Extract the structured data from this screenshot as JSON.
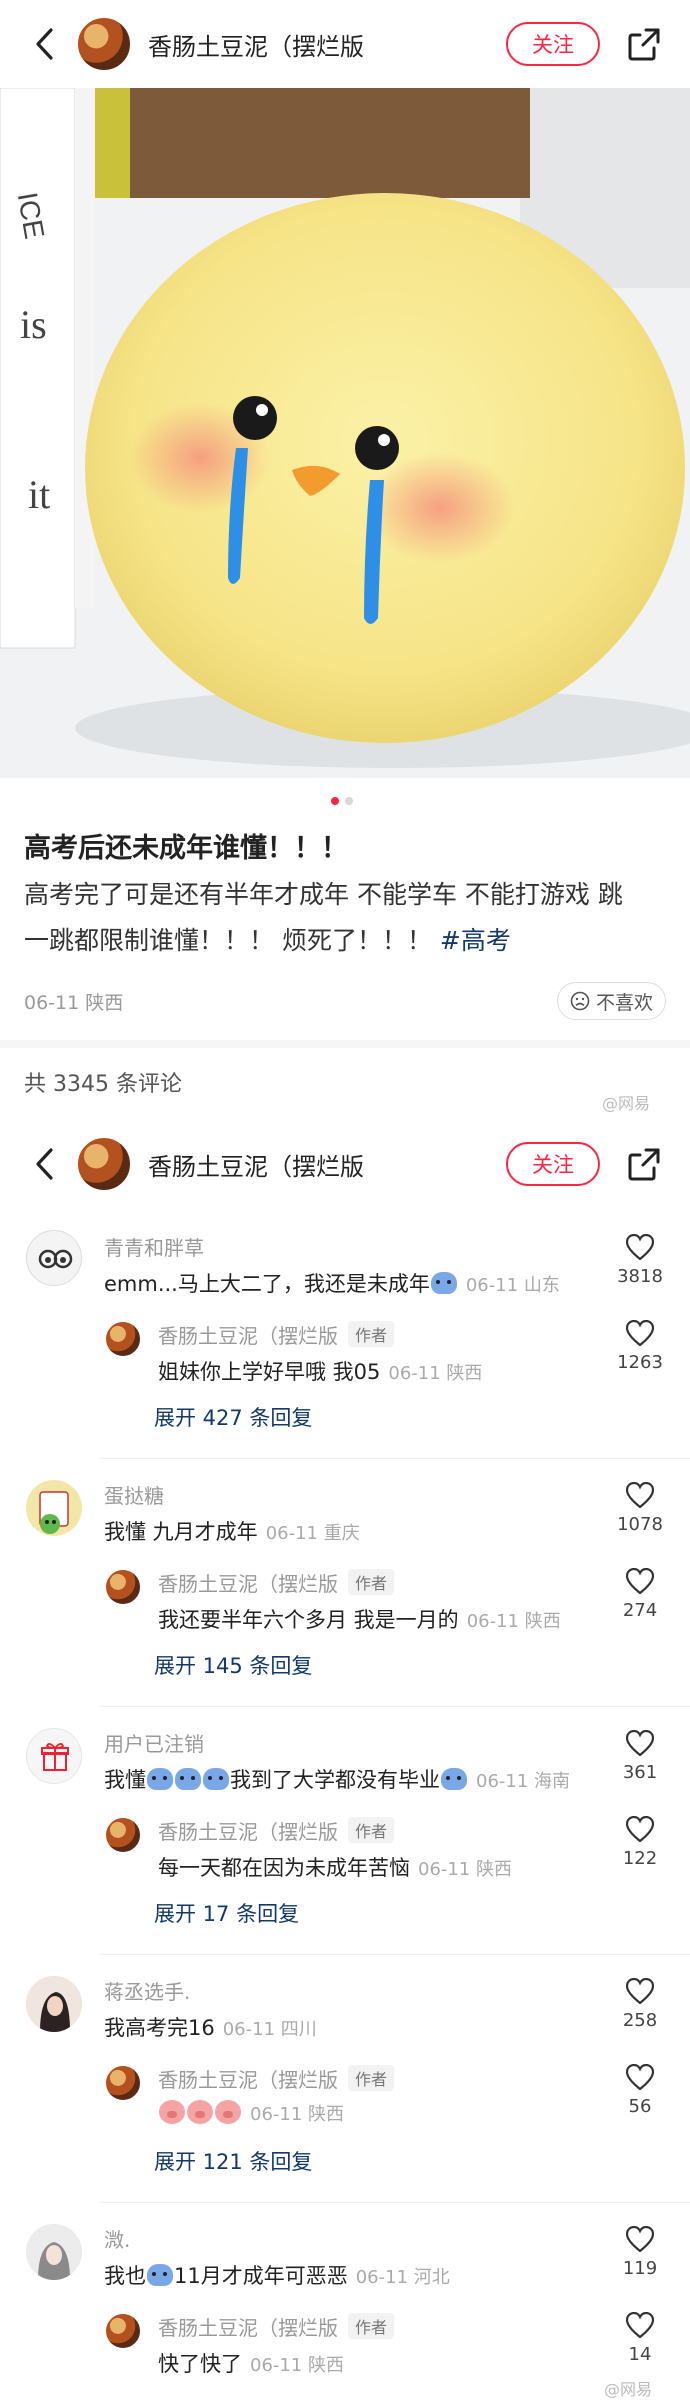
{
  "author": {
    "name": "香肠土豆泥（摆烂版",
    "follow_label": "关注"
  },
  "post": {
    "title": "高考后还未成年谁懂！！！",
    "body_line1": "高考完了可是还有半年才成年 不能学车 不能打游戏 跳",
    "body_line2": "一跳都限制谁懂！！！ 烦死了！！！ ",
    "tag": "#高考",
    "date_location": "06-11 陕西",
    "dislike_label": "不喜欢",
    "image_count": 2,
    "active_image": 1
  },
  "comments_header": {
    "count_label": "共 3345 条评论"
  },
  "watermark": "@网易",
  "author_tag_label": "作者",
  "threads": [
    {
      "name": "青青和胖草",
      "text": "emm...马上大二了，我还是未成年",
      "emoji": "cry",
      "meta": "06-11 山东",
      "likes": "3818",
      "reply": {
        "text": "姐妹你上学好早哦 我05",
        "meta": "06-11 陕西",
        "likes": "1263"
      },
      "expand": "展开 427 条回复"
    },
    {
      "name": "蛋挞糖",
      "text": "我懂 九月才成年",
      "meta": "06-11 重庆",
      "likes": "1078",
      "reply": {
        "text": "我还要半年六个多月 我是一月的",
        "meta": "06-11 陕西",
        "likes": "274"
      },
      "expand": "展开 145 条回复"
    },
    {
      "name": "用户已注销",
      "text_pre": "我懂",
      "text": "我到了大学都没有毕业",
      "meta": "06-11 海南",
      "likes": "361",
      "reply": {
        "text": "每一天都在因为未成年苦恼",
        "meta": "06-11 陕西",
        "likes": "122"
      },
      "expand": "展开 17 条回复"
    },
    {
      "name": "蒋丞选手.",
      "text": "我高考完16",
      "meta": "06-11 四川",
      "likes": "258",
      "reply": {
        "text": "",
        "meta": "06-11 陕西",
        "likes": "56"
      },
      "expand": "展开 121 条回复"
    },
    {
      "name": "溦.",
      "text_pre": "我也",
      "text": "11月才成年可恶恶",
      "meta": "06-11 河北",
      "likes": "119",
      "reply": {
        "text": "快了快了",
        "meta": "06-11 陕西",
        "likes": "14"
      }
    }
  ]
}
